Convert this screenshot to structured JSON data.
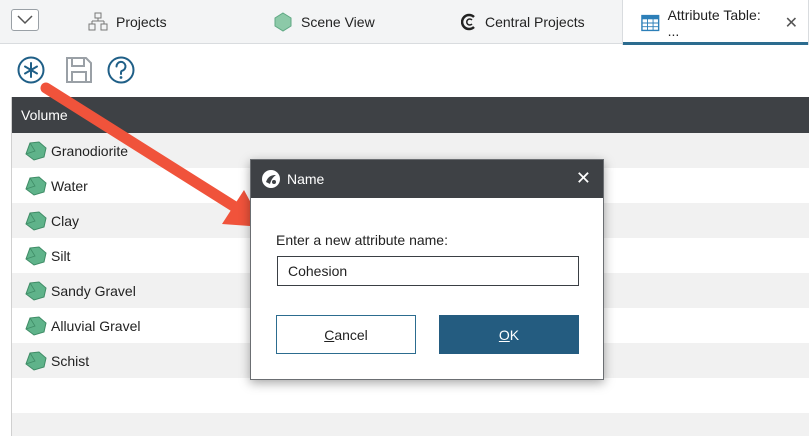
{
  "tabs": [
    {
      "label": "Projects",
      "icon": "projects-icon"
    },
    {
      "label": "Scene View",
      "icon": "scene-view-icon"
    },
    {
      "label": "Central Projects",
      "icon": "central-projects-icon"
    },
    {
      "label": "Attribute Table: ...",
      "icon": "attribute-table-icon",
      "active": true
    }
  ],
  "toolbar": {
    "new_attribute_icon": "asterisk-circle-icon",
    "save_icon": "save-icon",
    "help_icon": "help-icon"
  },
  "table": {
    "header": "Volume",
    "rows": [
      {
        "label": "Granodiorite"
      },
      {
        "label": "Water"
      },
      {
        "label": "Clay"
      },
      {
        "label": "Silt"
      },
      {
        "label": "Sandy Gravel"
      },
      {
        "label": "Alluvial Gravel"
      },
      {
        "label": "Schist"
      }
    ]
  },
  "dialog": {
    "title": "Name",
    "prompt": "Enter a new attribute name:",
    "input_value": "Cohesion",
    "cancel_label_first": "C",
    "cancel_label_rest": "ancel",
    "ok_label_first": "O",
    "ok_label_rest": "K"
  },
  "colors": {
    "header_dark": "#3e4145",
    "accent_blue": "#245c80",
    "arrow_red": "#f0533b",
    "volume_green": "#5fb38a"
  }
}
